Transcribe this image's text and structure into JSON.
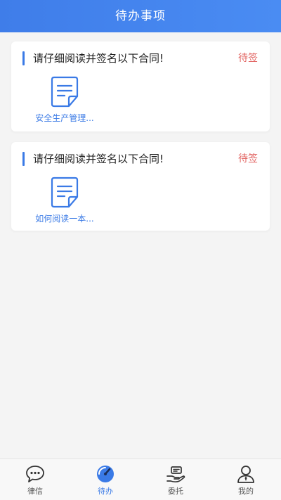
{
  "header": {
    "title": "待办事项"
  },
  "cards": [
    {
      "title": "请仔细阅读并签名以下合同!",
      "status": "待签",
      "doc_label": "安全生产管理..."
    },
    {
      "title": "请仔细阅读并签名以下合同!",
      "status": "待签",
      "doc_label": "如何阅读一本..."
    }
  ],
  "tabbar": {
    "tabs": [
      {
        "label": "律信",
        "icon": "chat-bubble-icon"
      },
      {
        "label": "待办",
        "icon": "todo-icon",
        "active": true
      },
      {
        "label": "委托",
        "icon": "hand-entrust-icon"
      },
      {
        "label": "我的",
        "icon": "user-profile-icon"
      }
    ]
  },
  "colors": {
    "header": "#4285f4",
    "accent": "#3a7ae6",
    "status": "#e26462",
    "background": "#f4f4f4"
  }
}
